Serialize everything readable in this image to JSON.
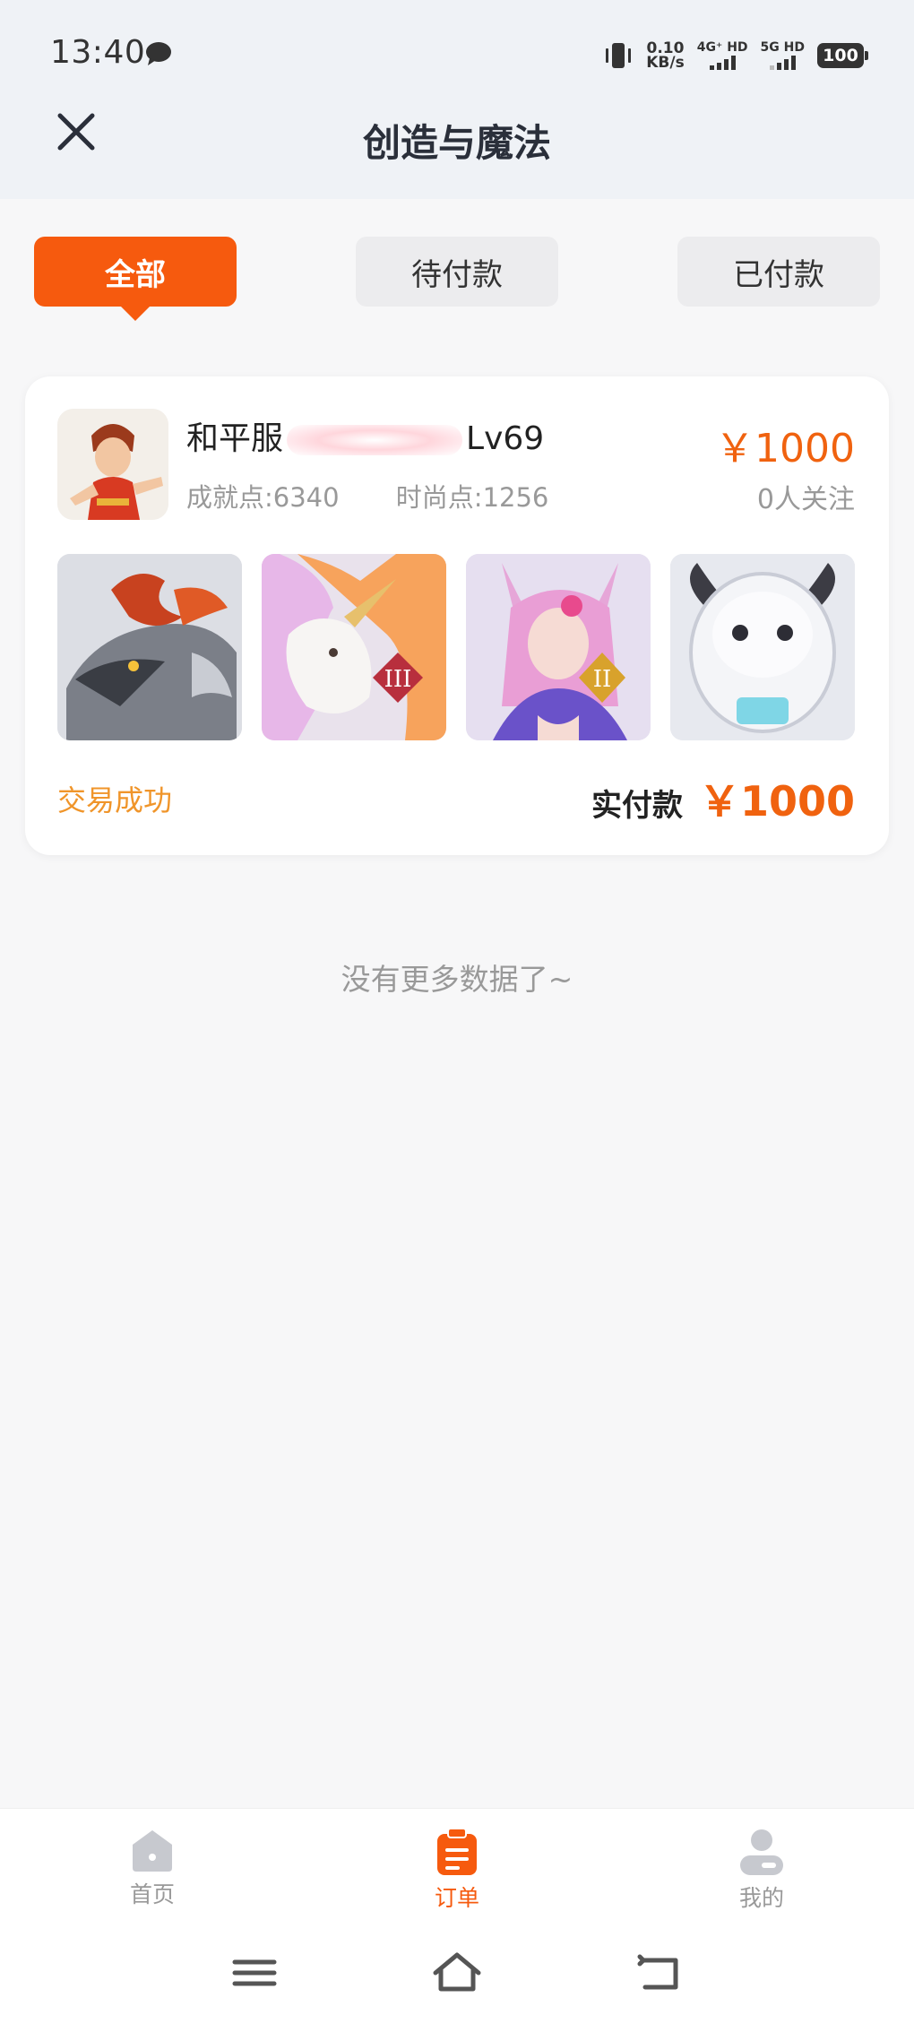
{
  "status_bar": {
    "time": "13:40",
    "net_speed_value": "0.10",
    "net_speed_unit": "KB/s",
    "sim1_label": "4G⁺ HD",
    "sim2_label": "5G HD",
    "battery": "100"
  },
  "header": {
    "title": "创造与魔法"
  },
  "tabs": [
    {
      "label": "全部",
      "active": true
    },
    {
      "label": "待付款",
      "active": false
    },
    {
      "label": "已付款",
      "active": false
    }
  ],
  "order": {
    "account_name_prefix": "和平服",
    "account_name_suffix": "Lv69",
    "achievement_points": "成就点:6340",
    "fashion_points": "时尚点:1256",
    "price": "￥1000",
    "followers": "0人关注",
    "thumbnails": [
      {
        "subject": "dragon-mount",
        "rank": ""
      },
      {
        "subject": "unicorn-mount",
        "rank": "III"
      },
      {
        "subject": "fox-spirit-character",
        "rank": "II"
      },
      {
        "subject": "white-creature-pet",
        "rank": ""
      }
    ],
    "status": "交易成功",
    "paid_label": "实付款",
    "paid_amount": "￥1000"
  },
  "list_footer": "没有更多数据了~",
  "bottom_nav": [
    {
      "label": "首页",
      "icon": "home-icon",
      "active": false
    },
    {
      "label": "订单",
      "icon": "order-list-icon",
      "active": true
    },
    {
      "label": "我的",
      "icon": "profile-icon",
      "active": false
    }
  ],
  "system_nav": {
    "icons": [
      "menu-icon",
      "home-icon",
      "back-icon"
    ]
  },
  "colors": {
    "accent": "#f65a0e",
    "price": "#f0620f",
    "success_status": "#f0952a",
    "header_bg": "#eff2f6"
  }
}
